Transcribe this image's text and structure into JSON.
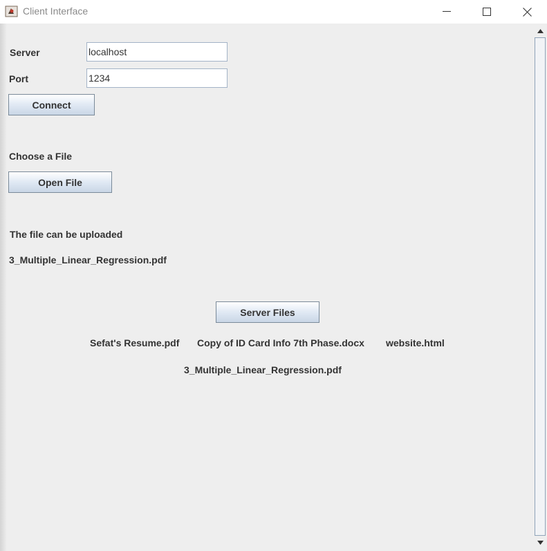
{
  "window": {
    "title": "Client Interface",
    "icons": {
      "app": "java-cup-icon",
      "minimize": "minimize-icon",
      "maximize": "maximize-icon",
      "close": "close-icon"
    }
  },
  "form": {
    "server_label": "Server",
    "server_value": "localhost",
    "port_label": "Port",
    "port_value": "1234",
    "connect_label": "Connect"
  },
  "file": {
    "choose_label": "Choose a File",
    "open_label": "Open File",
    "status": "The file can be uploaded",
    "selected": "3_Multiple_Linear_Regression.pdf"
  },
  "server": {
    "button_label": "Server Files",
    "files": [
      "Sefat's Resume.pdf",
      "Copy of ID Card Info 7th Phase.docx",
      "website.html",
      "3_Multiple_Linear_Regression.pdf"
    ]
  },
  "scrollbar": {
    "icons": {
      "up": "arrow-up-icon",
      "down": "arrow-down-icon"
    }
  },
  "colors": {
    "background": "#eeeeee",
    "button_gradient_top": "#ffffff",
    "button_gradient_bottom": "#c9d6e6",
    "border": "#a3b3c7"
  }
}
